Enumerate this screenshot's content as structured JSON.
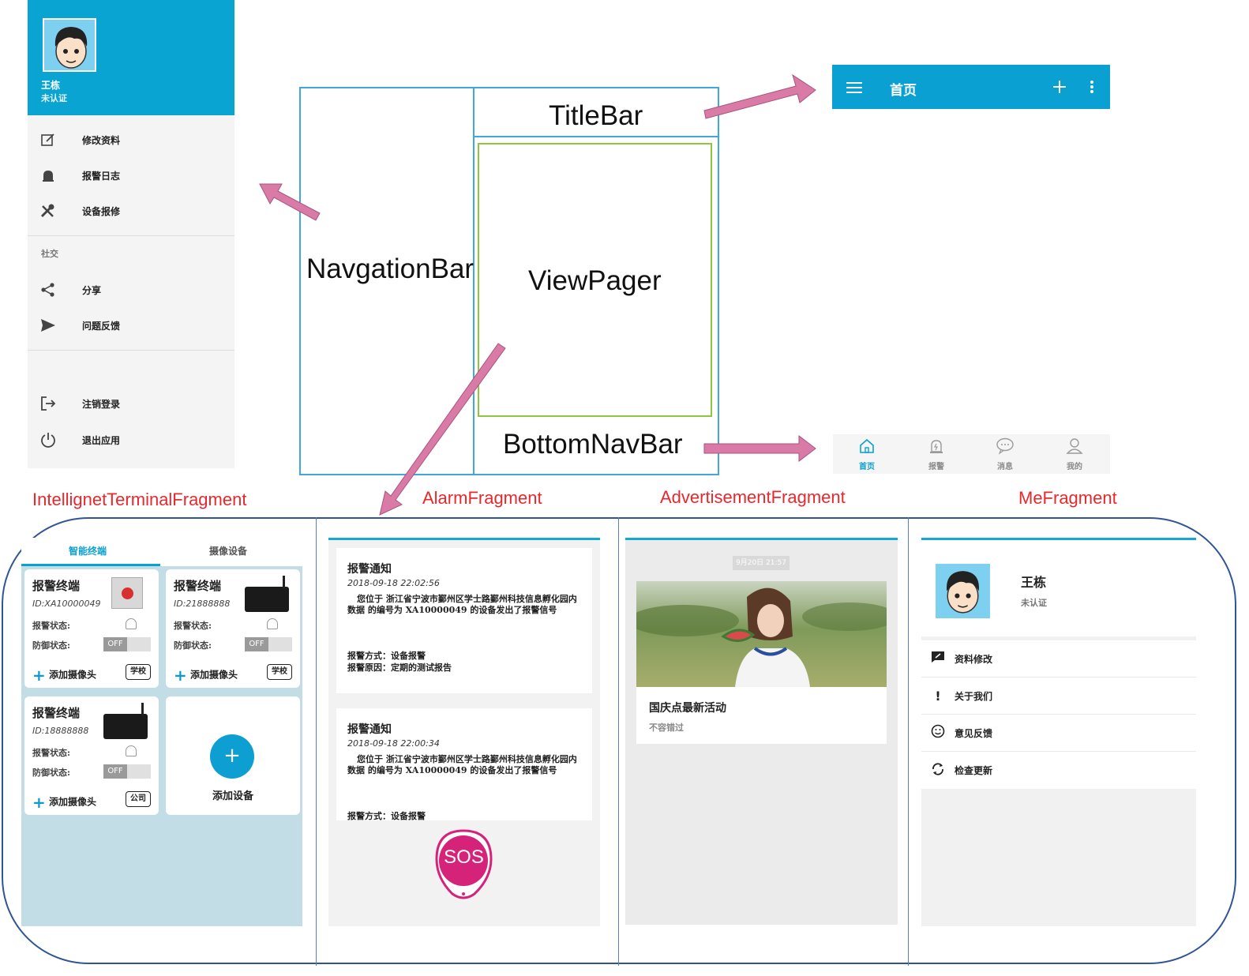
{
  "drawer": {
    "user_name": "王栋",
    "user_status": "未认证",
    "items_top": [
      {
        "label": "修改资料",
        "icon": "edit-icon"
      },
      {
        "label": "报警日志",
        "icon": "alarm-bell-icon"
      },
      {
        "label": "设备报修",
        "icon": "tools-icon"
      }
    ],
    "section_label": "社交",
    "items_social": [
      {
        "label": "分享",
        "icon": "share-icon"
      },
      {
        "label": "问题反馈",
        "icon": "send-icon"
      }
    ],
    "items_bottom": [
      {
        "label": "注销登录",
        "icon": "logout-icon"
      },
      {
        "label": "退出应用",
        "icon": "power-icon"
      }
    ]
  },
  "diagram": {
    "titlebar": "TitleBar",
    "navbar": "NavgationBar",
    "viewpager": "ViewPager",
    "bottomnav": "BottomNavBar"
  },
  "titlebar": {
    "title": "首页"
  },
  "bottomnav": {
    "items": [
      {
        "label": "首页",
        "icon": "home-icon",
        "active": true
      },
      {
        "label": "报警",
        "icon": "alarm-icon",
        "active": false
      },
      {
        "label": "消息",
        "icon": "message-icon",
        "active": false
      },
      {
        "label": "我的",
        "icon": "user-icon",
        "active": false
      }
    ]
  },
  "fragments": {
    "terminal": "IntellignetTerminalFragment",
    "alarm": "AlarmFragment",
    "advertisement": "AdvertisementFragment",
    "me": "MeFragment"
  },
  "terminal": {
    "tabs": [
      "智能终端",
      "摄像设备"
    ],
    "cards": [
      {
        "name": "报警终端",
        "id": "ID:XA10000049",
        "alarm_status": "报警状态:",
        "defense_status": "防御状态:",
        "toggle": "OFF",
        "add_camera": "添加摄像头",
        "badge": "学校"
      },
      {
        "name": "报警终端",
        "id": "ID:21888888",
        "alarm_status": "报警状态:",
        "defense_status": "防御状态:",
        "toggle": "OFF",
        "add_camera": "添加摄像头",
        "badge": "学校"
      },
      {
        "name": "报警终端",
        "id": "ID:18888888",
        "alarm_status": "报警状态:",
        "defense_status": "防御状态:",
        "toggle": "OFF",
        "add_camera": "添加摄像头",
        "badge": "公司"
      }
    ],
    "add_device": "添加设备"
  },
  "alarm": {
    "cards": [
      {
        "title": "报警通知",
        "time": "2018-09-18 22:02:56",
        "body": "您位于 浙江省宁波市鄞州区学士路鄞州科技信息孵化园内数据 的编号为 XA10000049 的设备发出了报警信号",
        "method": "报警方式：设备报警",
        "reason": "报警原因：定期的测试报告"
      },
      {
        "title": "报警通知",
        "time": "2018-09-18 22:00:34",
        "body": "您位于 浙江省宁波市鄞州区学士路鄞州科技信息孵化园内数据 的编号为 XA10000049 的设备发出了报警信号",
        "method": "报警方式：设备报警"
      }
    ],
    "sos": "SOS"
  },
  "advertisement": {
    "time": "9月20日 21:57",
    "title": "国庆点最新活动",
    "subtitle": "不容错过"
  },
  "me": {
    "name": "王栋",
    "status": "未认证",
    "items": [
      {
        "label": "资料修改",
        "icon": "edit-comment-icon"
      },
      {
        "label": "关于我们",
        "icon": "exclamation-icon"
      },
      {
        "label": "意见反馈",
        "icon": "smiley-icon"
      },
      {
        "label": "检查更新",
        "icon": "sync-icon"
      }
    ]
  },
  "colors": {
    "primary": "#0aa4d3",
    "arrow": "#d97ba6",
    "label_red": "#e8282d",
    "sos": "#d6237a"
  }
}
